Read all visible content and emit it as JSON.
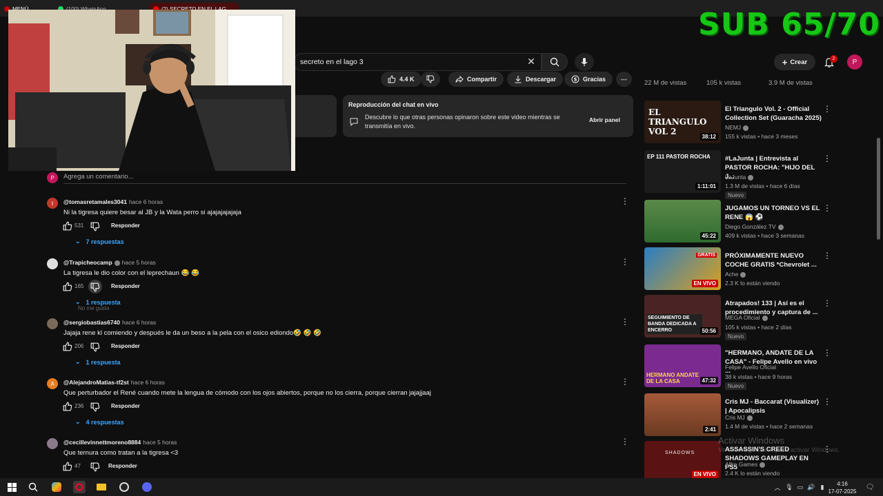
{
  "browser": {
    "menu_label": "MENÚ",
    "tab_whatsapp": "(100) WhatsApp",
    "tab_active": "(2) SECRETO EN EL LAG"
  },
  "overlay": {
    "sub_counter": "SUB 65/70"
  },
  "header": {
    "search_value": "secreto en el lago 3",
    "create_label": "Crear",
    "notifications_count": "2",
    "avatar_letter": "P"
  },
  "actions": {
    "likes": "4.4 K",
    "share": "Compartir",
    "download": "Descargar",
    "thanks": "Gracias"
  },
  "chat_replay": {
    "title": "Reproducción del chat en vivo",
    "description": "Descubre lo que otras personas opinaron sobre este video mientras se transmitía en vivo.",
    "open_label": "Abrir panel"
  },
  "add_comment": {
    "avatar": "P",
    "placeholder": "Agrega un comentario..."
  },
  "comments": [
    {
      "avatar": "t",
      "avatar_color": "#c0392b",
      "author": "@tomasretamales3041",
      "time": "hace 6 horas",
      "text": "Ni la tigresa quiere besar al JB y la Wata perro si ajajajajajaja",
      "likes": "531",
      "reply": "Responder",
      "replies": "7 respuestas"
    },
    {
      "avatar": "",
      "avatar_color": "#e0e0e0",
      "author": "@Trapicheocamp",
      "time": "hace 5 horas",
      "text": "La tigresa le dio color con el leprechaun 😂 😂",
      "likes": "165",
      "reply": "Responder",
      "replies": "1 respuesta",
      "tooltip": "No me gusta"
    },
    {
      "avatar": "",
      "avatar_color": "#7a6a5a",
      "author": "@sergiobastias6740",
      "time": "hace 6 horas",
      "text": "Jajaja rene kl comiendo y después le da un beso a la pela con el osico ediondo🤣 🤣 🤣",
      "likes": "206",
      "reply": "Responder",
      "replies": "1 respuesta"
    },
    {
      "avatar": "A",
      "avatar_color": "#e67e22",
      "author": "@AlejandroMatias-tf2st",
      "time": "hace 6 horas",
      "text": "Que perturbador el René cuando mete la lengua de cómodo con los ojos abiertos, porque no los cierra, porque cierran jajajjaaj",
      "likes": "236",
      "reply": "Responder",
      "replies": "4 respuestas"
    },
    {
      "avatar": "",
      "avatar_color": "#8a7a8a",
      "author": "@cecillevinnettmoreno8884",
      "time": "hace 5 horas",
      "text": "Que ternura como tratan a la tigresa <3",
      "likes": "47",
      "reply": "Responder"
    }
  ],
  "sidebar": {
    "top_views": [
      "22 M de vistas",
      "105 k vistas",
      "3.9 M de vistas"
    ],
    "items": [
      {
        "title": "El Triangulo Vol. 2 - Official Collection Set (Guaracha 2025)",
        "thumb_text": "EL TRIANGULO VOL 2",
        "channel": "NEMJ",
        "meta": "155 k vistas • hace 3 meses",
        "duration": "38:12",
        "thumb_color": "#2a1a12"
      },
      {
        "title": "#LaJunta | Entrevista al PASTOR ROCHA: \"HIJO DEL J...",
        "thumb_text": "EP 111  PASTOR ROCHA",
        "channel": "LaJunta",
        "meta": "1.3 M de vistas • hace 6 días",
        "duration": "1:11:01",
        "badge": "Nuevo",
        "thumb_color": "#1c1c1c"
      },
      {
        "title": "JUGAMOS UN TORNEO VS EL RENE 😱 ⚽",
        "thumb_text": "",
        "channel": "Diego González TV",
        "meta": "409 k vistas • hace 3 semanas",
        "duration": "45:22",
        "thumb_color": "#2f6b2f"
      },
      {
        "title": "PRÓXIMAMENTE NUEVO COCHE GRATIS *Chevrolet ...",
        "thumb_text": "GRATIS",
        "channel": "Ache",
        "meta": "2.3 K lo están viendo",
        "live": "EN VIVO",
        "thumb_color": "#2a7ec4"
      },
      {
        "title": "Atrapados! 133 | Así es el procedimiento y captura de ...",
        "thumb_text": "SEGUIMIENTO DE BANDA DEDICADA A ENCERRO",
        "channel": "MEGA Oficial",
        "meta": "105 k vistas • hace 2 días",
        "duration": "50:56",
        "badge": "Nuevo",
        "thumb_color": "#4a2424"
      },
      {
        "title": "\"HERMANO, ANDATE DE LA CASA\" - Felipe Avello en vivo ...",
        "thumb_text": "HERMANO ANDATE DE LA CASA",
        "channel": "Felipe Avello Oficial",
        "meta": "38 k vistas • hace 9 horas",
        "duration": "47:32",
        "badge": "Nuevo",
        "thumb_color": "#7b2b8f"
      },
      {
        "title": "Cris MJ - Baccarat (Visualizer) | Apocalipsis",
        "thumb_text": "",
        "channel": "Cris MJ",
        "meta": "1.4 M de vistas • hace 2 semanas",
        "duration": "2:41",
        "thumb_color": "#8a4a32"
      },
      {
        "title": "ASSASSIN'S CREED SHADOWS GAMEPLAY EN PS5",
        "thumb_text": "SHADOWS",
        "channel": "Alfre Games",
        "meta": "2.4 K lo están viendo",
        "live": "EN VIVO",
        "thumb_color": "#5a1212"
      }
    ]
  },
  "windows": {
    "activate_title": "Activar Windows",
    "activate_sub": "Ve a Configuración para activar Windows.",
    "time": "4:16",
    "date": "17-07-2025"
  }
}
